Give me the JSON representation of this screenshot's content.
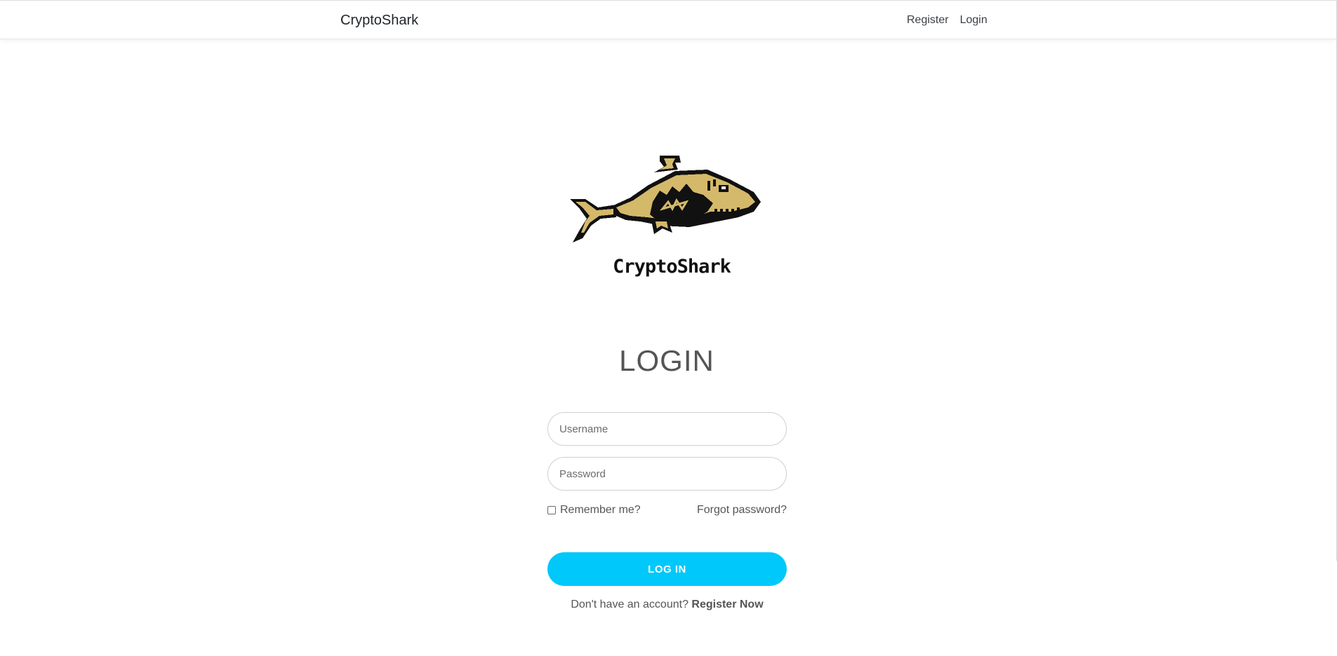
{
  "navbar": {
    "brand": "CryptoShark",
    "links": [
      {
        "label": "Register"
      },
      {
        "label": "Login"
      }
    ]
  },
  "logo": {
    "icon": "pixel-shark-icon",
    "text": "CryptoShark",
    "colors": {
      "body": "#d4b96a",
      "outline": "#111111"
    }
  },
  "login": {
    "title": "LOGIN",
    "username": {
      "placeholder": "Username",
      "value": ""
    },
    "password": {
      "placeholder": "Password",
      "value": ""
    },
    "remember_label": "Remember me?",
    "remember_checked": false,
    "forgot_label": "Forgot password?",
    "submit_label": "LOG IN",
    "no_account_text": "Don't have an account?",
    "register_label": "Register Now"
  },
  "colors": {
    "accent": "#00c8fa",
    "text": "#555555"
  }
}
